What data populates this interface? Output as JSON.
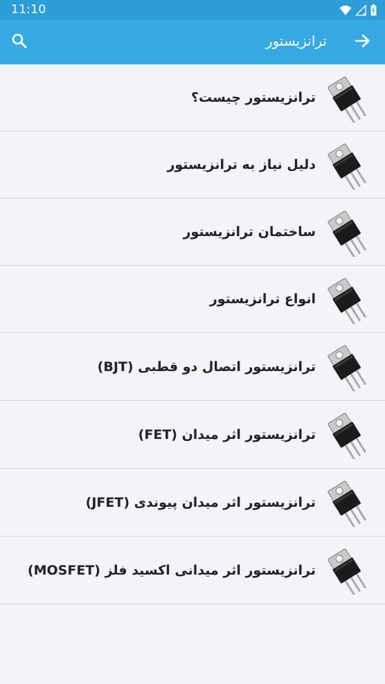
{
  "status_bar": {
    "time": "11:10",
    "icons": [
      "wifi-icon",
      "signal-icon",
      "battery-icon"
    ]
  },
  "app_bar": {
    "title": "ترانزیستور",
    "back_icon": "arrow-right-icon",
    "search_icon": "search-icon"
  },
  "colors": {
    "status_bar": "#2d9ed8",
    "app_bar": "#37a9e3",
    "background": "#f3f4f8",
    "divider": "#d7d9de",
    "text": "#222222"
  },
  "items": [
    {
      "label": "ترانزیستور چیست؟",
      "icon": "transistor-icon"
    },
    {
      "label": "دلیل نیاز به ترانزیستور",
      "icon": "transistor-icon"
    },
    {
      "label": "ساختمان ترانزیستور",
      "icon": "transistor-icon"
    },
    {
      "label": "انواع ترانزیستور",
      "icon": "transistor-icon"
    },
    {
      "label": "ترانزیستور اتصال دو قطبی (BJT)",
      "icon": "transistor-icon"
    },
    {
      "label": "ترانزیستور اثر میدان (FET)",
      "icon": "transistor-icon"
    },
    {
      "label": "ترانزیستور اثر میدان پیوندی (JFET)",
      "icon": "transistor-icon"
    },
    {
      "label": "ترانزیستور اثر میدانی اکسید فلز (MOSFET)",
      "icon": "transistor-icon"
    }
  ]
}
